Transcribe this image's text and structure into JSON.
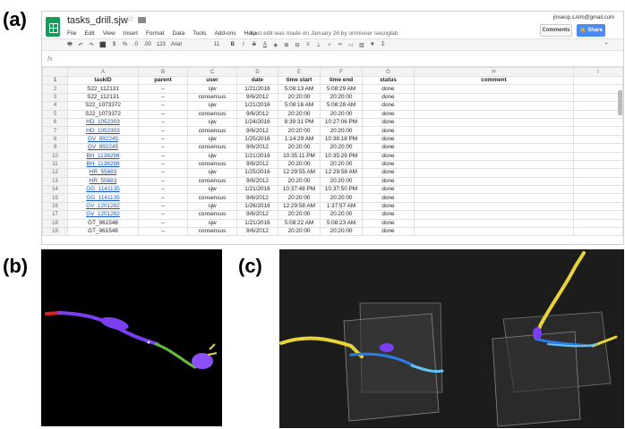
{
  "labels": {
    "a": "(a)",
    "b": "(b)",
    "c": "(c)"
  },
  "app": {
    "title": "tasks_drill.sjw",
    "menu": [
      "File",
      "Edit",
      "View",
      "Insert",
      "Format",
      "Data",
      "Tools",
      "Add-ons",
      "Help"
    ],
    "last_edit": "Last edit was made on January 26 by omniuser seunglab",
    "user": "jinseop.s.kim@gmail.com",
    "comments_label": "Comments",
    "share_label": "Share",
    "font": "Arial",
    "font_size": "11",
    "toolbar": {
      "print": "🖶",
      "undo": "↶",
      "redo": "↷",
      "paint": "⬛",
      "currency": "$",
      "percent": "%",
      "dec_less": ".0",
      "dec_more": ".00",
      "more_formats": "123",
      "bold": "B",
      "italic": "I",
      "strike": "S",
      "text_color": "A",
      "fill": "◈",
      "borders": "⊞",
      "merge": "⊟",
      "align": "≡",
      "valign": "⊥",
      "wrap": "⤶",
      "link": "∞",
      "comment": "▭",
      "chart": "▥",
      "filter": "▼",
      "functions": "Σ",
      "collapse": "⌃"
    },
    "fx": "fx"
  },
  "grid": {
    "column_letters": [
      "A",
      "B",
      "C",
      "D",
      "E",
      "F",
      "G",
      "H",
      "I"
    ],
    "header": [
      "taskID",
      "parent",
      "user",
      "date",
      "time start",
      "time end",
      "status",
      "comment",
      ""
    ],
    "rows": [
      [
        "S22_112131",
        "--",
        "sjw",
        "1/21/2016",
        "5:08:13 AM",
        "5:08:29 AM",
        "done"
      ],
      [
        "S22_112131",
        "--",
        "consensus",
        "9/6/2012",
        "20:20:00",
        "20:20:00",
        "done"
      ],
      [
        "S22_1073372",
        "--",
        "sjw",
        "1/21/2016",
        "5:08:16 AM",
        "5:08:28 AM",
        "done"
      ],
      [
        "S22_1073372",
        "--",
        "consensus",
        "9/6/2012",
        "20:20:00",
        "20:20:00",
        "done"
      ],
      [
        "HD_1052303",
        "--",
        "sjw",
        "1/24/2016",
        "8:39:31 PM",
        "10:27:06 PM",
        "done"
      ],
      [
        "HD_1052303",
        "--",
        "consensus",
        "9/6/2012",
        "20:20:00",
        "20:20:00",
        "done"
      ],
      [
        "GV_892245",
        "--",
        "sjw",
        "1/25/2016",
        "1:14:29 AM",
        "10:38:18 PM",
        "done"
      ],
      [
        "GV_892245",
        "--",
        "consensus",
        "9/6/2012",
        "20:20:00",
        "20:20:00",
        "done"
      ],
      [
        "BH_1138298",
        "--",
        "sjw",
        "1/21/2016",
        "10:35:11 PM",
        "10:35:29 PM",
        "done"
      ],
      [
        "BH_1138298",
        "--",
        "consensus",
        "9/6/2012",
        "20:20:00",
        "20:20:00",
        "done"
      ],
      [
        "HR_55683",
        "--",
        "sjw",
        "1/25/2016",
        "12:29:55 AM",
        "12:29:58 AM",
        "done"
      ],
      [
        "HR_55683",
        "--",
        "consensus",
        "9/6/2012",
        "20:20:00",
        "20:20:00",
        "done"
      ],
      [
        "GG_1141135",
        "--",
        "sjw",
        "1/21/2016",
        "10:37:48 PM",
        "10:37:50 PM",
        "done"
      ],
      [
        "GG_1141135",
        "--",
        "consensus",
        "9/6/2012",
        "20:20:00",
        "20:20:00",
        "done"
      ],
      [
        "GV_1201282",
        "--",
        "sjw",
        "1/26/2016",
        "12:29:58 AM",
        "1:37:57 AM",
        "done"
      ],
      [
        "GV_1201282",
        "--",
        "consensus",
        "9/6/2012",
        "20:20:00",
        "20:20:00",
        "done"
      ],
      [
        "GT_961548",
        "--",
        "sjw",
        "1/21/2016",
        "5:08:22 AM",
        "5:08:23 AM",
        "done"
      ],
      [
        "GT_961548",
        "--",
        "consensus",
        "9/6/2012",
        "20:20:00",
        "20:20:00",
        "done"
      ]
    ],
    "link_rows": [
      4,
      5,
      6,
      7,
      8,
      9,
      10,
      11,
      12,
      13,
      14,
      15
    ]
  },
  "colors": {
    "sheets_green": "#0f9d58",
    "share_blue": "#4a8af4",
    "link_blue": "#1155cc",
    "neuron_violet": "#7b3ff2",
    "neuron_green": "#5fc23a",
    "neuron_red": "#e0201c",
    "neuron_yellow": "#e8d43a",
    "neuron_blue": "#2c7ce8",
    "neuron_cyan": "#63c6f2"
  }
}
